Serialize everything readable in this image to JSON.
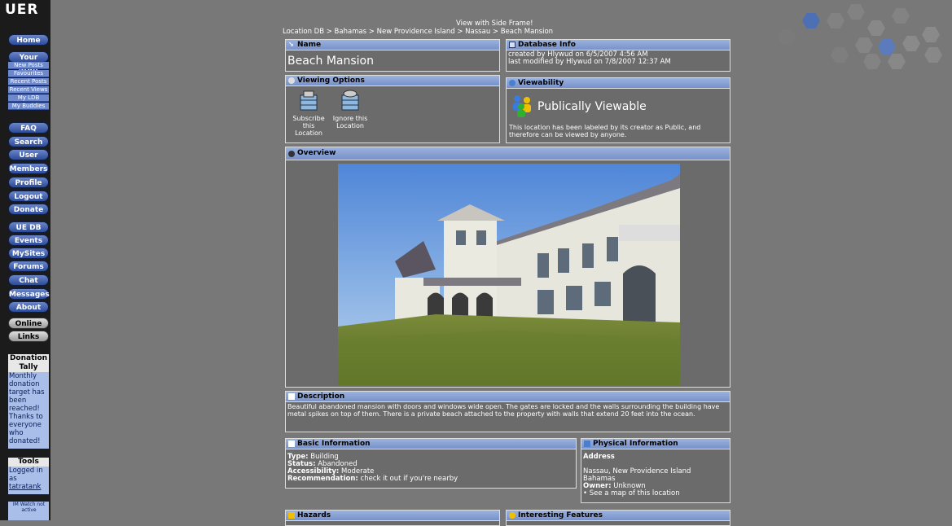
{
  "sidebar": {
    "logo": "UER",
    "buttons": [
      {
        "label": "Home",
        "style": "blue"
      },
      {
        "label": "Your Stuff",
        "style": "blue"
      },
      {
        "label": "FAQ",
        "style": "blue"
      },
      {
        "label": "Search",
        "style": "blue"
      },
      {
        "label": "User Srch",
        "style": "blue"
      },
      {
        "label": "Members",
        "style": "blue"
      },
      {
        "label": "Profile",
        "style": "blue"
      },
      {
        "label": "Logout",
        "style": "blue"
      },
      {
        "label": "Donate",
        "style": "blue"
      },
      {
        "label": "UE DB",
        "style": "blue"
      },
      {
        "label": "Events",
        "style": "blue"
      },
      {
        "label": "MySites",
        "style": "blue"
      },
      {
        "label": "Forums",
        "style": "blue"
      },
      {
        "label": "Chat",
        "style": "blue"
      },
      {
        "label": "Messages",
        "style": "blue"
      },
      {
        "label": "About",
        "style": "blue"
      },
      {
        "label": "Online",
        "style": "grey"
      },
      {
        "label": "Links",
        "style": "grey"
      }
    ],
    "sub_items": [
      "New Posts",
      "Favourites",
      "Recent Posts",
      "Recent Views",
      "My LDB",
      "My Buddies"
    ],
    "donation": {
      "title": "Donation Tally",
      "text": "Monthly donation target has been reached! Thanks to everyone who donated!"
    },
    "tools": {
      "title": "Tools",
      "logged_in_text": "Logged in as",
      "username": "tatratank"
    },
    "imwatch": "IM Watch not active"
  },
  "header": {
    "view_link": "View with Side Frame!",
    "breadcrumb": "Location DB > Bahamas > New Providence Island > Nassau > Beach Mansion"
  },
  "name_panel": {
    "title": "Name",
    "value": "Beach Mansion"
  },
  "db_panel": {
    "title": "Database Info",
    "created": "created by Hlywud on 6/5/2007 4:56 AM",
    "modified": "last modified by Hlywud on 7/8/2007 12:37 AM"
  },
  "viewing_options": {
    "title": "Viewing Options",
    "subscribe": "Subscribe this Location",
    "ignore": "Ignore this Location"
  },
  "viewability": {
    "title": "Viewability",
    "status": "Publically Viewable",
    "text": "This location has been labeled by its creator as Public, and therefore can be viewed by anyone."
  },
  "overview": {
    "title": "Overview"
  },
  "description": {
    "title": "Description",
    "text": "Beautiful abandoned mansion with doors and windows wide open. The gates are locked and the walls surrounding the building have metal spikes on top of them. There is a private beach attached to the property with walls that extend 20 feet into the ocean."
  },
  "basic_info": {
    "title": "Basic Information",
    "type_label": "Type:",
    "type": "Building",
    "status_label": "Status:",
    "status": "Abandoned",
    "access_label": "Accessibility:",
    "access": "Moderate",
    "rec_label": "Recommendation:",
    "rec": "check it out if you're nearby"
  },
  "physical_info": {
    "title": "Physical Information",
    "address_label": "Address",
    "address_line1": "Nassau, New Providence Island",
    "address_line2": "Bahamas",
    "owner_label": "Owner:",
    "owner": "Unknown",
    "map_link": "See a map of this location"
  },
  "hazards": {
    "title": "Hazards"
  },
  "features": {
    "title": "Interesting Features"
  },
  "colors": {
    "accent": "#7891c9",
    "panel": "#6b6b6b",
    "background": "#787878",
    "sidebar": "#1b1b1b"
  }
}
